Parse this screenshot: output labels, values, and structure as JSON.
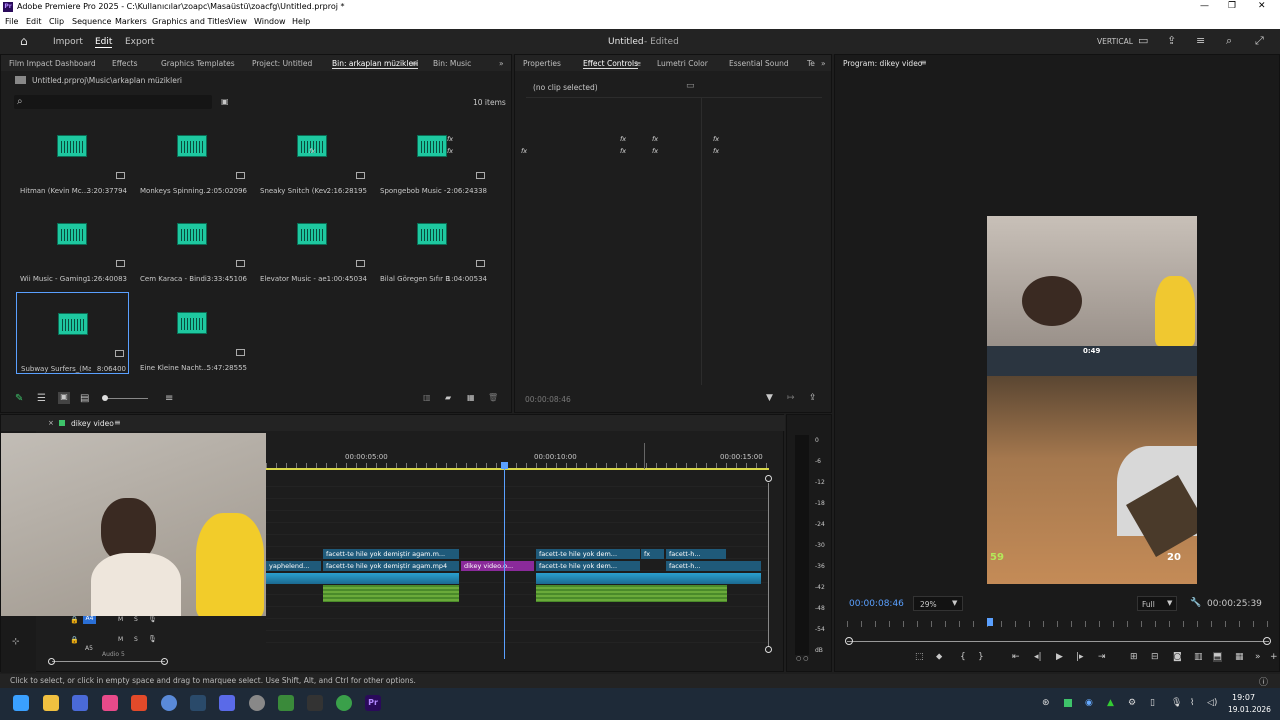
{
  "window": {
    "title": "Adobe Premiere Pro 2025 - C:\\Kullanıcılar\\zoapc\\Masaüstü\\zoacfg\\Untitled.prproj *",
    "app_icon": "Pr"
  },
  "menu": [
    "File",
    "Edit",
    "Clip",
    "Sequence",
    "Markers",
    "Graphics and Titles",
    "View",
    "Window",
    "Help"
  ],
  "workspace": {
    "import": "Import",
    "edit": "Edit",
    "export": "Export",
    "project_title": "Untitled",
    "status": "- Edited",
    "layout": "VERTICAL"
  },
  "project_panel": {
    "tabs": [
      "Film Impact Dashboard",
      "Effects",
      "Graphics Templates",
      "Project: Untitled",
      "Bin: arkaplan müzikleri",
      "Bin: Music"
    ],
    "path": "Untitled.prproj\\Music\\arkaplan müzikleri",
    "items_count": "10 items",
    "search_placeholder": "",
    "items": [
      {
        "name": "Hitman (Kevin Mc...",
        "duration": "3:20:37794"
      },
      {
        "name": "Monkeys Spinning...",
        "duration": "2:05:02096"
      },
      {
        "name": "Sneaky Snitch (Kev...",
        "duration": "2:16:28195"
      },
      {
        "name": "Spongebob Music -...",
        "duration": "2:06:24338"
      },
      {
        "name": "Wii Music - Gaming...",
        "duration": "1:26:40083"
      },
      {
        "name": "Cem Karaca - Bindi...",
        "duration": "3:33:45106"
      },
      {
        "name": "Elevator Music - ae...",
        "duration": "1:00:45034"
      },
      {
        "name": "Bilal Göregen Sıfır B...",
        "duration": "1:04:00534"
      },
      {
        "name": "Subway Surfers_(Mai...",
        "duration": "8:06400"
      },
      {
        "name": "Eine Kleine Nacht...",
        "duration": "5:47:28555"
      }
    ]
  },
  "effect_panel": {
    "tabs": [
      "Properties",
      "Effect Controls",
      "Lumetri Color",
      "Essential Sound",
      "Te"
    ],
    "no_clip": "(no clip selected)",
    "timecode": "00:00:08:46"
  },
  "program_panel": {
    "title": "Program: dikey video",
    "timecode": "00:00:08:46",
    "zoom": "29%",
    "quality": "Full",
    "duration": "00:00:25:39",
    "hud_time": "0:49",
    "hud_score_left": "59",
    "hud_score_right": "20"
  },
  "timeline": {
    "sequence": "dikey video",
    "ruler": [
      "00:00:05:00",
      "00:00:10:00",
      "00:00:15:00"
    ],
    "meter_labels": [
      "0",
      "-6",
      "-12",
      "-18",
      "-24",
      "-30",
      "-36",
      "-42",
      "-48",
      "-54",
      "dB"
    ],
    "clips_v2": [
      "facett-te hile yok demiştir agam.m...",
      "facett-te hile yok dem...",
      "facett-h..."
    ],
    "clips_v1": [
      "yaphelend...",
      "facett-te hile yok demiştir agam.mp4",
      "dikey video.o...",
      "facett-te hile yok dem...",
      "facett-h..."
    ],
    "track_a4": "A4",
    "track_a5": "A5",
    "audio5": "Audio 5",
    "fx": "fx"
  },
  "status_bar": "Click to select, or click in empty space and drag to marquee select. Use Shift, Alt, and Ctrl for other options.",
  "taskbar": {
    "time": "19:07",
    "date": "19.01.2026"
  }
}
